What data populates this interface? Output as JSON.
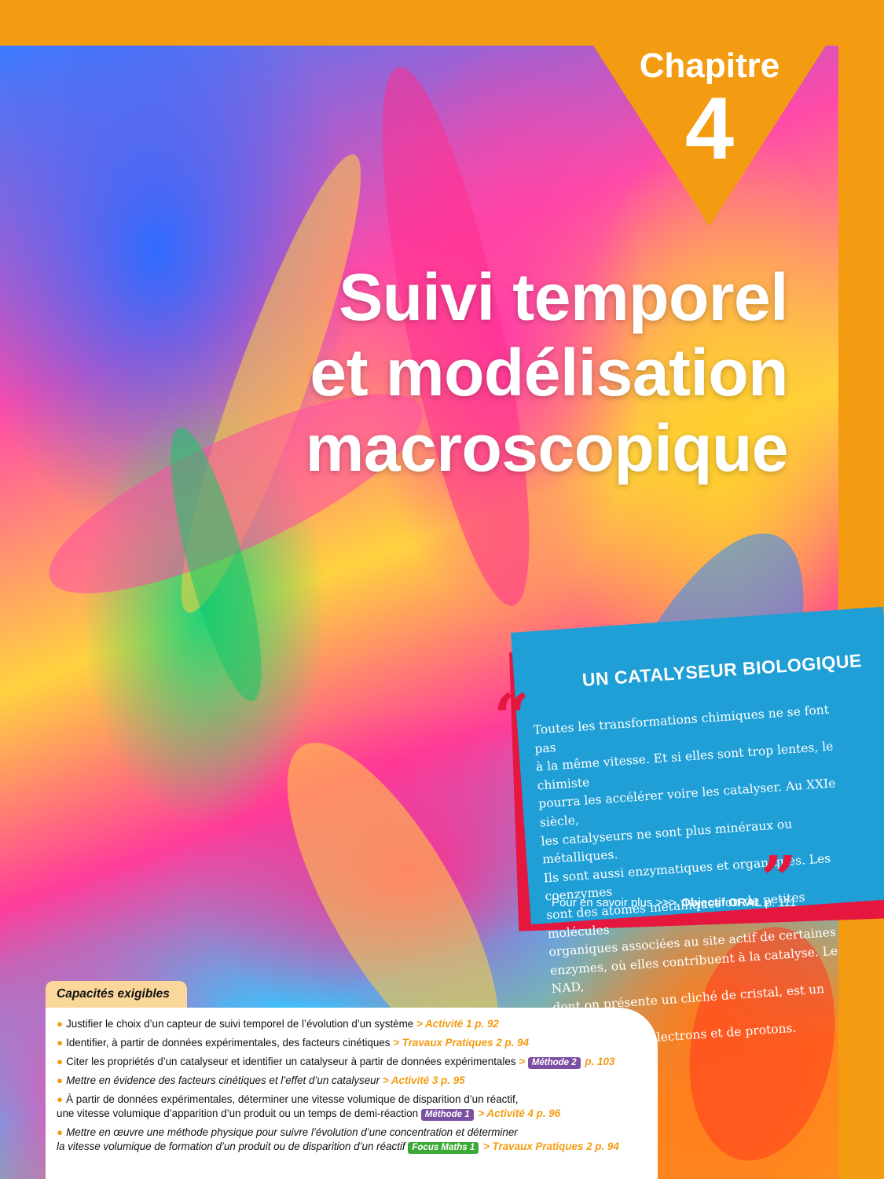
{
  "chapter": {
    "label": "Chapitre",
    "number": "4"
  },
  "title": {
    "lines": [
      "Suivi temporel",
      "et modélisation",
      "macroscopique"
    ]
  },
  "quote": {
    "heading": "UN CATALYSEUR BIOLOGIQUE",
    "open_mark": "“",
    "close_mark": "”",
    "lines": [
      "Toutes les transformations chimiques ne se font pas",
      "à la même vitesse. Et si elles sont trop lentes, le chimiste",
      "pourra les accélérer voire les catalyser. Au XXIe siècle,",
      "les catalyseurs ne sont plus minéraux ou métalliques.",
      "Ils sont aussi enzymatiques et organiques. Les coenzymes",
      "sont des atomes métalliques ou de petites molécules",
      "organiques associées au site actif de certaines",
      "enzymes, où elles contribuent à la catalyse. Le NAD,",
      "dont on présente un cliché de cristal, est un coenzyme",
      "transporteur d’électrons et de protons."
    ],
    "more_prefix": "Pour en savoir plus >>>",
    "more_link": "Objectif ORAL",
    "more_page": "p. 111"
  },
  "capacities": {
    "title": "Capacités exigibles",
    "items": [
      {
        "text": "Justifier le choix d’un capteur de suivi temporel de l’évolution d’un système",
        "ref": "> Activité 1 p. 92"
      },
      {
        "text": "Identifier, à partir de données expérimentales, des facteurs cinétiques",
        "ref": "> Travaux Pratiques 2 p. 94"
      },
      {
        "text": "Citer les propriétés d’un catalyseur et identifier un catalyseur à partir de données expérimentales",
        "ref_prefix": ">",
        "badge": "Méthode 2",
        "ref": "p. 103"
      },
      {
        "text": "Mettre en évidence des facteurs cinétiques et l’effet d’un catalyseur",
        "ref": "> Activité 3 p. 95"
      },
      {
        "text": "À partir de données expérimentales, déterminer une vitesse volumique de disparition d’un réactif,",
        "text2": "une vitesse volumique d’apparition d’un produit ou un temps de demi-réaction",
        "badge": "Méthode 1",
        "ref": "> Activité 4 p. 96"
      },
      {
        "text": "Mettre en œuvre une méthode physique pour suivre l’évolution d’une concentration et déterminer",
        "text2": "la vitesse volumique de formation d’un produit ou de disparition d’un réactif",
        "badge": "Focus Maths 1",
        "ref": "> Travaux Pratiques 2 p. 94"
      }
    ]
  },
  "colors": {
    "accent": "#f39c12",
    "quote_bg": "#1f9fd6",
    "quote_mark": "#e5173f",
    "method_badge": "#7b4fa2",
    "focus_badge": "#3aa935"
  }
}
